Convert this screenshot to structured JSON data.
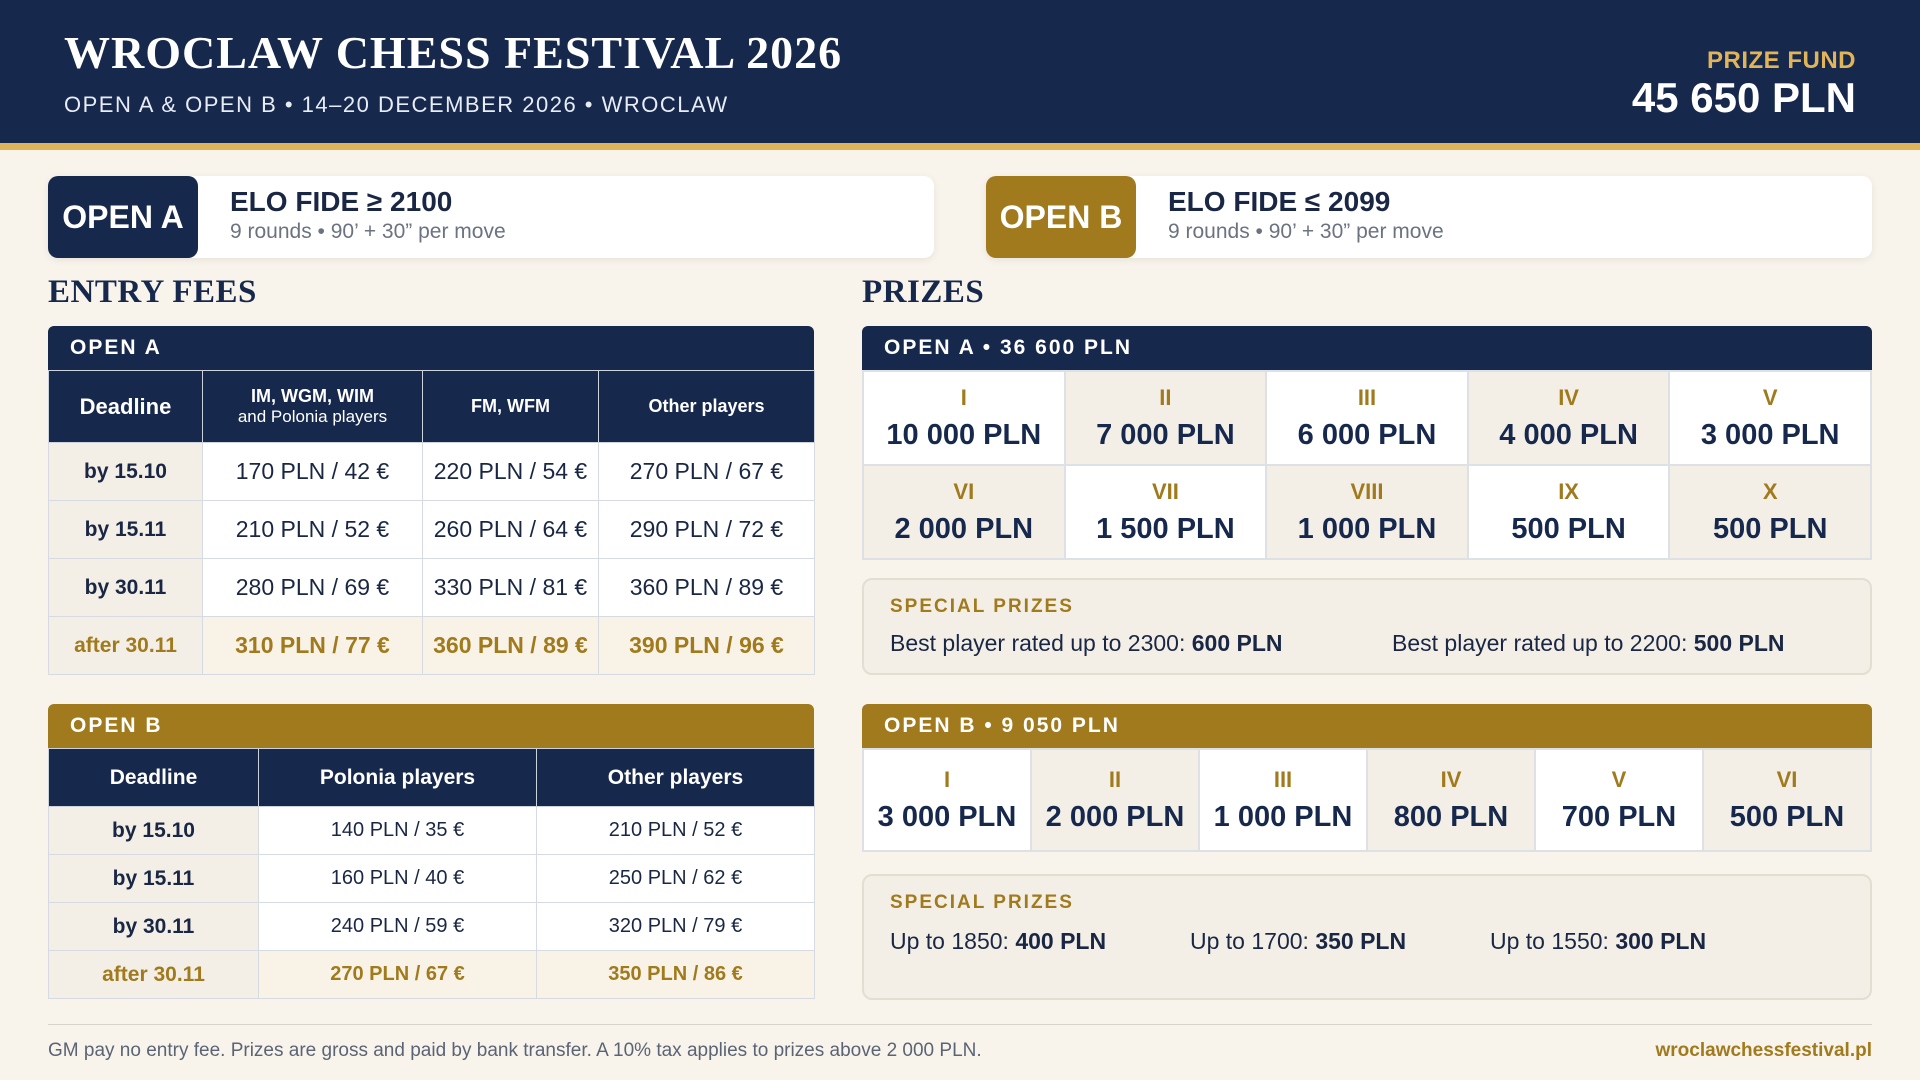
{
  "header": {
    "title": "WROCLAW CHESS FESTIVAL 2026",
    "subtitle": "OPEN A & OPEN B • 14–20 DECEMBER 2026 • WROCLAW",
    "prize_fund_label": "PRIZE FUND",
    "prize_fund_value": "45 650 PLN"
  },
  "open_cards": [
    {
      "badge": "OPEN A",
      "elo": "ELO FIDE ≥ 2100",
      "rounds": "9 rounds • 90’ + 30” per move",
      "color": "#17284d"
    },
    {
      "badge": "OPEN B",
      "elo": "ELO FIDE ≤ 2099",
      "rounds": "9 rounds • 90’ + 30” per move",
      "color": "#a07a1c"
    }
  ],
  "entry_fees": {
    "title": "ENTRY FEES",
    "open_a": {
      "bar": "OPEN A",
      "headers": [
        {
          "main": "Deadline",
          "sub": ""
        },
        {
          "main": "IM, WGM, WIM",
          "sub": "and Polonia players"
        },
        {
          "main": "FM, WFM",
          "sub": ""
        },
        {
          "main": "Other players",
          "sub": ""
        }
      ],
      "rows": [
        [
          "by 15.10",
          "170 PLN / 42 €",
          "220 PLN / 54 €",
          "270 PLN / 67 €"
        ],
        [
          "by 15.11",
          "210 PLN / 52 €",
          "260 PLN / 64 €",
          "290 PLN / 72 €"
        ],
        [
          "by 30.11",
          "280 PLN / 69 €",
          "330 PLN / 81 €",
          "360 PLN / 89 €"
        ],
        [
          "after 30.11",
          "310 PLN / 77 €",
          "360 PLN / 89 €",
          "390 PLN / 96 €"
        ]
      ]
    },
    "open_b": {
      "bar": "OPEN B",
      "headers": [
        "Deadline",
        "Polonia players",
        "Other players"
      ],
      "rows": [
        [
          "by 15.10",
          "140 PLN / 35 €",
          "210 PLN / 52 €"
        ],
        [
          "by 15.11",
          "160 PLN / 40 €",
          "250 PLN / 62 €"
        ],
        [
          "by 30.11",
          "240 PLN / 59 €",
          "320 PLN / 79 €"
        ],
        [
          "after 30.11",
          "270 PLN / 67 €",
          "350 PLN / 86 €"
        ]
      ]
    }
  },
  "prizes": {
    "title": "PRIZES",
    "open_a": {
      "bar": "OPEN A • 36 600 PLN",
      "places": [
        {
          "rank": "I",
          "amount": "10 000 PLN"
        },
        {
          "rank": "II",
          "amount": "7 000 PLN"
        },
        {
          "rank": "III",
          "amount": "6 000 PLN"
        },
        {
          "rank": "IV",
          "amount": "4 000 PLN"
        },
        {
          "rank": "V",
          "amount": "3 000 PLN"
        },
        {
          "rank": "VI",
          "amount": "2 000 PLN"
        },
        {
          "rank": "VII",
          "amount": "1 500 PLN"
        },
        {
          "rank": "VIII",
          "amount": "1 000 PLN"
        },
        {
          "rank": "IX",
          "amount": "500 PLN"
        },
        {
          "rank": "X",
          "amount": "500 PLN"
        }
      ],
      "special_label": "SPECIAL PRIZES",
      "special": [
        {
          "label": "Best player rated up to 2300: ",
          "amount": "600 PLN"
        },
        {
          "label": "Best player rated up to 2200: ",
          "amount": "500 PLN"
        }
      ]
    },
    "open_b": {
      "bar": "OPEN B • 9 050 PLN",
      "places": [
        {
          "rank": "I",
          "amount": "3 000 PLN"
        },
        {
          "rank": "II",
          "amount": "2 000 PLN"
        },
        {
          "rank": "III",
          "amount": "1 000 PLN"
        },
        {
          "rank": "IV",
          "amount": "800 PLN"
        },
        {
          "rank": "V",
          "amount": "700 PLN"
        },
        {
          "rank": "VI",
          "amount": "500 PLN"
        }
      ],
      "special_label": "SPECIAL PRIZES",
      "special": [
        {
          "label": "Up to 1850: ",
          "amount": "400 PLN"
        },
        {
          "label": "Up to 1700: ",
          "amount": "350 PLN"
        },
        {
          "label": "Up to 1550: ",
          "amount": "300 PLN"
        }
      ]
    }
  },
  "footer": {
    "note": "GM pay no entry fee. Prizes are gross and paid by bank transfer. A 10% tax applies to prizes above 2 000 PLN.",
    "url": "wroclawchessfestival.pl"
  }
}
